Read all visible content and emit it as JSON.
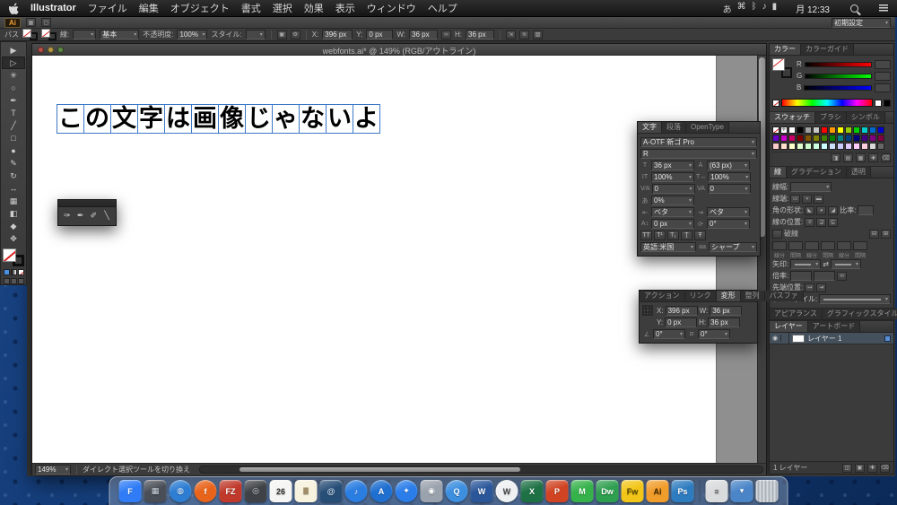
{
  "menubar": {
    "app_name": "Illustrator",
    "menus": [
      "ファイル",
      "編集",
      "オブジェクト",
      "書式",
      "選択",
      "効果",
      "表示",
      "ウィンドウ",
      "ヘルプ"
    ],
    "status_icons": [
      "あ",
      "⌘",
      "ᛒ",
      "♪",
      "▮"
    ],
    "clock": "月 12:33"
  },
  "appbar": {
    "logo": "Ai",
    "workspace": "初期設定"
  },
  "controlbar": {
    "selection_label": "パス",
    "stroke_label": "線:",
    "brush_value": "基本",
    "opacity_label": "不透明度:",
    "opacity_value": "100%",
    "style_label": "スタイル:",
    "x_label": "X:",
    "x_value": "396 px",
    "y_label": "Y:",
    "y_value": "0 px",
    "w_label": "W:",
    "w_value": "36 px",
    "h_label": "H:",
    "h_value": "36 px"
  },
  "toolbar": {
    "tools": [
      {
        "name": "selection-tool",
        "glyph": "▶"
      },
      {
        "name": "direct-selection-tool",
        "glyph": "▷"
      },
      {
        "name": "magic-wand-tool",
        "glyph": "✳"
      },
      {
        "name": "lasso-tool",
        "glyph": "○"
      },
      {
        "name": "pen-tool",
        "glyph": "✒"
      },
      {
        "name": "type-tool",
        "glyph": "T"
      },
      {
        "name": "line-segment-tool",
        "glyph": "╱"
      },
      {
        "name": "rectangle-tool",
        "glyph": "□"
      },
      {
        "name": "paintbrush-tool",
        "glyph": "●"
      },
      {
        "name": "pencil-tool",
        "glyph": "✎"
      },
      {
        "name": "rotate-tool",
        "glyph": "↻"
      },
      {
        "name": "width-tool",
        "glyph": "↔"
      },
      {
        "name": "free-transform-tool",
        "glyph": "▦"
      },
      {
        "name": "gradient-tool",
        "glyph": "◧"
      },
      {
        "name": "eyedropper-tool",
        "glyph": "◆"
      },
      {
        "name": "hand-tool",
        "glyph": "✥"
      }
    ]
  },
  "document": {
    "title": "webfonts.ai* @ 149% (RGB/アウトライン)",
    "canvas_text": "この文字は画像じゃないよ",
    "zoom": "149%",
    "status_hint": "ダイレクト選択ツールを切り換え"
  },
  "character_panel": {
    "tabs": [
      "文字",
      "段落",
      "OpenType"
    ],
    "font_family": "A-OTF 新ゴ Pro",
    "font_style": "R",
    "font_size": "36 px",
    "leading": "(63 px)",
    "vertical_scale": "100%",
    "horizontal_scale": "100%",
    "kerning": "0",
    "tracking": "0",
    "tsume": "0%",
    "aki_left": "ベタ",
    "aki_right": "ベタ",
    "baseline_shift": "0 px",
    "char_rotation": "0°",
    "tt_icons": [
      "TT",
      "T¹",
      "T₁",
      "Ṯ",
      "Ŧ"
    ],
    "language": "英語:米国",
    "aa_icon": "aa",
    "antialias": "シャープ"
  },
  "transform_panel": {
    "tabs": [
      "アクション",
      "リンク",
      "変形",
      "整列",
      "パスファ"
    ],
    "x_label": "X:",
    "x_value": "396 px",
    "y_label": "Y:",
    "y_value": "0 px",
    "w_label": "W:",
    "w_value": "36 px",
    "h_label": "H:",
    "h_value": "36 px",
    "rotate_value": "0°",
    "shear_value": "0°"
  },
  "color_panel": {
    "tabs": [
      "カラー",
      "カラーガイド"
    ],
    "channels": [
      "R",
      "G",
      "B"
    ]
  },
  "swatches_panel": {
    "tabs": [
      "スウォッチ",
      "ブラシ",
      "シンボル"
    ],
    "swatches": [
      "none",
      "reg",
      "#ffffff",
      "#000000",
      "#a0a0a0",
      "#c8c8c8",
      "#ff0000",
      "#ff9900",
      "#ffff00",
      "#99cc00",
      "#00cc00",
      "#00cccc",
      "#0066cc",
      "#0000cc",
      "#6600cc",
      "#cc00cc",
      "#cc0066",
      "#800000",
      "#805500",
      "#808000",
      "#408000",
      "#008000",
      "#008080",
      "#004080",
      "#000080",
      "#400080",
      "#800080",
      "#800040",
      "#ffcccc",
      "#ffe0cc",
      "#ffffcc",
      "#e0ffcc",
      "#ccffcc",
      "#ccffe0",
      "#ccffff",
      "#cce0ff",
      "#ccccff",
      "#e0ccff",
      "#ffccff",
      "#ffcce0",
      "#d9d9d9",
      "#666666"
    ],
    "footer_icons": [
      "◨",
      "▤",
      "▦",
      "✚",
      "⌫"
    ]
  },
  "stroke_panel": {
    "tabs": [
      "線",
      "グラデーション",
      "透明"
    ],
    "weight_label": "線幅:",
    "cap_label": "線端:",
    "corner_label": "角の形状:",
    "limit_label": "比率:",
    "align_label": "線の位置:",
    "dash_label": "破線",
    "dash_cells": [
      "線分",
      "間隔",
      "線分",
      "間隔",
      "線分",
      "間隔"
    ],
    "arrow_label": "矢印:",
    "scale_label": "倍率:",
    "tip_label": "先端位置:",
    "profile_label": "プロファイル:"
  },
  "appearance_panel": {
    "tabs": [
      "アピアランス",
      "グラフィックスタイル"
    ]
  },
  "layers_panel": {
    "tabs": [
      "レイヤー",
      "アートボード"
    ],
    "layer_name": "レイヤー 1",
    "count_label": "1 レイヤー",
    "footer_icons": [
      "◫",
      "▣",
      "✚",
      "⌫"
    ]
  },
  "eyedropper_panel": {
    "tools": [
      {
        "name": "eyedropper-tool",
        "glyph": "✑"
      },
      {
        "name": "live-paint-tool",
        "glyph": "✒"
      },
      {
        "name": "measure-tool",
        "glyph": "✐"
      },
      {
        "name": "ruler-tool",
        "glyph": "╲"
      }
    ]
  },
  "dock": {
    "items": [
      {
        "name": "finder",
        "label": "F",
        "color": "#2f7cf6",
        "fg": "#ffffff",
        "shape": "square"
      },
      {
        "name": "mission-control",
        "label": "▦",
        "color": "#4a4f57",
        "fg": "#cfd6e0",
        "shape": "square"
      },
      {
        "name": "earth-browser",
        "label": "◍",
        "color": "#2d7dd2",
        "fg": "#eaf4ff",
        "shape": "circle"
      },
      {
        "name": "firefox",
        "label": "f",
        "color": "#e8641b",
        "fg": "#ffffff",
        "shape": "circle"
      },
      {
        "name": "filezilla",
        "label": "FZ",
        "color": "#c0392b",
        "fg": "#ffffff",
        "shape": "square"
      },
      {
        "name": "photo-booth",
        "label": "◎",
        "color": "#3f4347",
        "fg": "#d8dde2",
        "shape": "square"
      },
      {
        "name": "calendar",
        "label": "26",
        "color": "#f5f5f3",
        "fg": "#333333",
        "shape": "square"
      },
      {
        "name": "notes",
        "label": "≣",
        "color": "#f7f2de",
        "fg": "#8a6d3b",
        "shape": "square"
      },
      {
        "name": "mail",
        "label": "@",
        "color": "#274e77",
        "fg": "#cfe0f2",
        "shape": "square"
      },
      {
        "name": "itunes",
        "label": "♪",
        "color": "#2a7de1",
        "fg": "#ffffff",
        "shape": "circle"
      },
      {
        "name": "app-store",
        "label": "A",
        "color": "#1f6fd0",
        "fg": "#ffffff",
        "shape": "circle"
      },
      {
        "name": "safari",
        "label": "✦",
        "color": "#2b7de9",
        "fg": "#ffffff",
        "shape": "circle"
      },
      {
        "name": "contacts",
        "label": "◉",
        "color": "#9aa2ad",
        "fg": "#ffffff",
        "shape": "square"
      },
      {
        "name": "quicktime",
        "label": "Q",
        "color": "#3d8fe0",
        "fg": "#ffffff",
        "shape": "circle"
      },
      {
        "name": "word",
        "label": "W",
        "color": "#2b579a",
        "fg": "#ffffff",
        "shape": "square"
      },
      {
        "name": "wordpress",
        "label": "W",
        "color": "#eef0f2",
        "fg": "#464646",
        "shape": "circle"
      },
      {
        "name": "excel",
        "label": "X",
        "color": "#1e7145",
        "fg": "#ffffff",
        "shape": "square"
      },
      {
        "name": "powerpoint",
        "label": "P",
        "color": "#d04423",
        "fg": "#ffffff",
        "shape": "square"
      },
      {
        "name": "messenger",
        "label": "M",
        "color": "#35b24a",
        "fg": "#ffffff",
        "shape": "square"
      },
      {
        "name": "dreamweaver",
        "label": "Dw",
        "color": "#2e9e4f",
        "fg": "#ffffff",
        "shape": "square"
      },
      {
        "name": "fireworks",
        "label": "Fw",
        "color": "#f2c618",
        "fg": "#5a4a00",
        "shape": "square"
      },
      {
        "name": "illustrator",
        "label": "Ai",
        "color": "#f09d2c",
        "fg": "#4a2e00",
        "shape": "square"
      },
      {
        "name": "photoshop",
        "label": "Ps",
        "color": "#2e7cc0",
        "fg": "#ffffff",
        "shape": "square"
      },
      {
        "name": "separator",
        "label": "",
        "color": "",
        "fg": "",
        "shape": "sep"
      },
      {
        "name": "text-document",
        "label": "≡",
        "color": "#d9dbdd",
        "fg": "#555555",
        "shape": "square"
      },
      {
        "name": "downloads",
        "label": "▾",
        "color": "#4a85c8",
        "fg": "#ffffff",
        "shape": "square"
      },
      {
        "name": "trash",
        "label": "",
        "color": "#c3c9cf",
        "fg": "#888888",
        "shape": "trash"
      }
    ]
  },
  "colors": {
    "selection_blue": "#3c78c8",
    "accent": "#5a8fd8"
  }
}
